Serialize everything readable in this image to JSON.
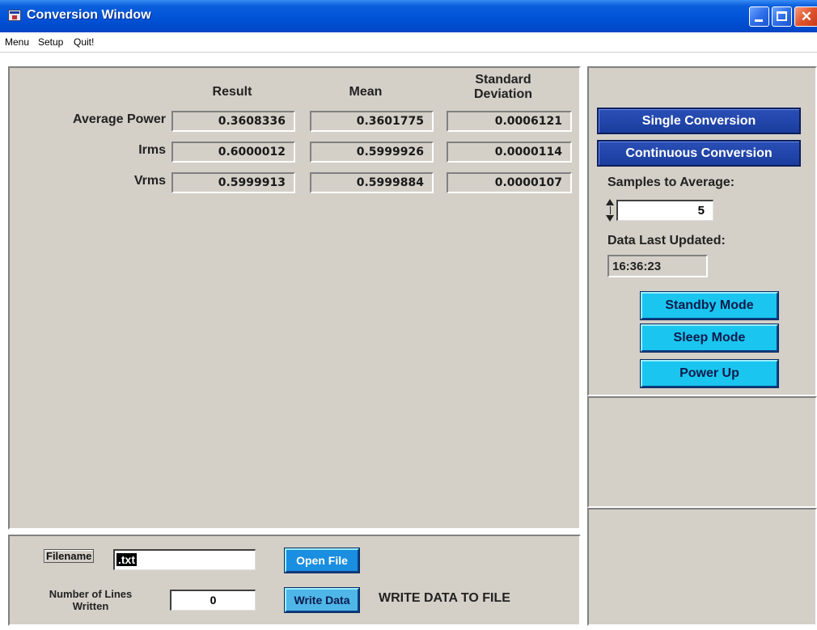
{
  "window": {
    "title": "Conversion Window"
  },
  "menu": [
    "Menu",
    "Setup",
    "Quit!"
  ],
  "table": {
    "headers": [
      "Result",
      "Mean",
      "Standard Deviation"
    ],
    "rows": [
      {
        "label": "Average Power",
        "values": [
          "0.3608336",
          "0.3601775",
          "0.0006121"
        ]
      },
      {
        "label": "Irms",
        "values": [
          "0.6000012",
          "0.5999926",
          "0.0000114"
        ]
      },
      {
        "label": "Vrms",
        "values": [
          "0.5999913",
          "0.5999884",
          "0.0000107"
        ]
      }
    ]
  },
  "controls": {
    "single_conversion": "Single Conversion",
    "continuous_conversion": "Continuous Conversion",
    "samples_label": "Samples to Average:",
    "samples_value": "5",
    "updated_label": "Data Last Updated:",
    "updated_value": "16:36:23",
    "standby": "Standby Mode",
    "sleep": "Sleep Mode",
    "power_up": "Power Up"
  },
  "file": {
    "filename_label": "Filename",
    "filename_value": ".txt",
    "lines_label_1": "Number of Lines",
    "lines_label_2": "Written",
    "lines_value": "0",
    "open_file": "Open File",
    "write_data": "Write Data",
    "caption": "WRITE DATA TO FILE"
  },
  "colors": {
    "title_bar": "#0052d6",
    "panel_bg": "#d4d0c8",
    "primary_button": "#1a3d9e",
    "mode_button": "#1ac6f0"
  }
}
